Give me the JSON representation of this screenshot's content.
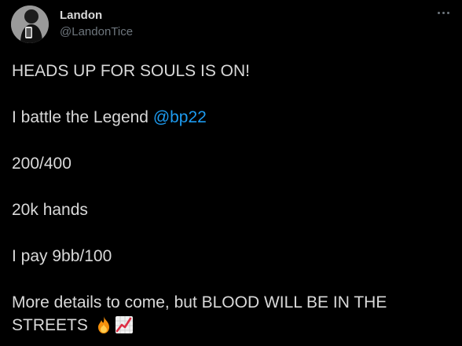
{
  "author": {
    "name": "Landon",
    "handle": "@LandonTice"
  },
  "tweet": {
    "line1": "HEADS UP FOR SOULS IS ON!",
    "line2_prefix": "I battle the Legend ",
    "line2_mention": "@bp22",
    "line3": "200/400",
    "line4": "20k hands",
    "line5": "I pay 9bb/100",
    "line6": "More details to come, but BLOOD WILL BE IN THE",
    "line7": "STREETS",
    "emojis": [
      "fire-emoji",
      "chart-increasing-emoji"
    ]
  },
  "colors": {
    "background": "#000000",
    "text": "#d9d9d9",
    "secondary": "#6e767d",
    "link": "#1d9bf0"
  },
  "icons": {
    "more": "more-options-icon"
  }
}
